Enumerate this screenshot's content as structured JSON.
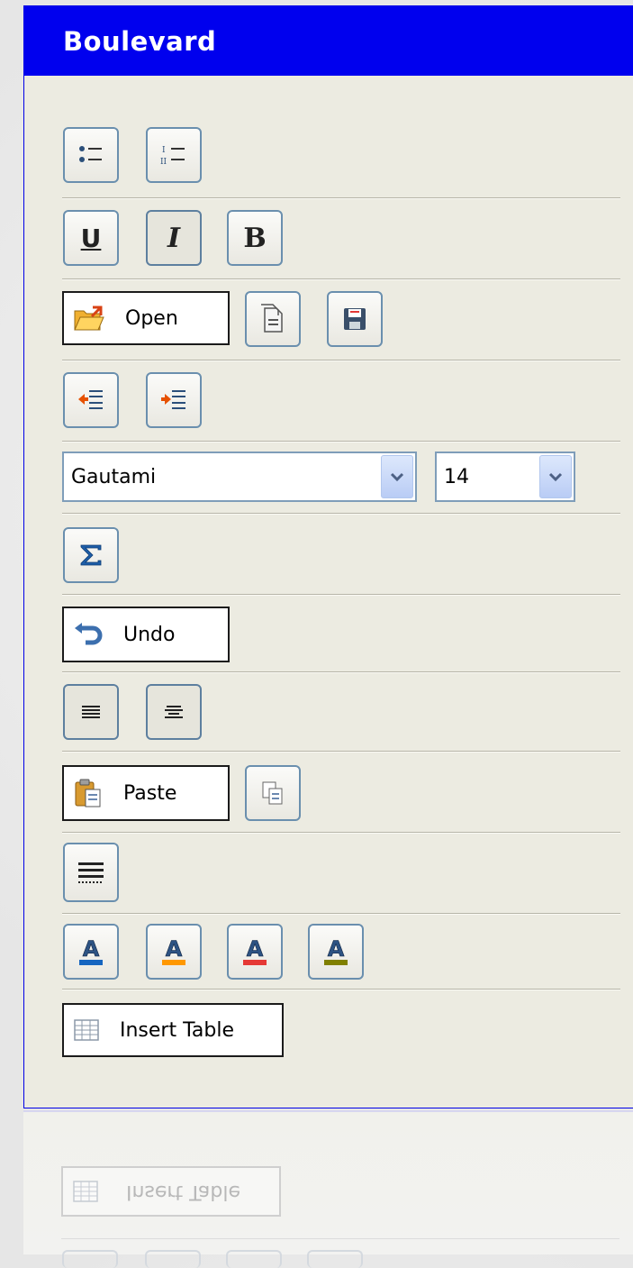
{
  "panel": {
    "title": "Boulevard"
  },
  "toolbar": {
    "list_buttons": [
      {
        "icon": "bulleted-list-icon"
      },
      {
        "icon": "numbered-list-icon"
      }
    ],
    "format_buttons": [
      {
        "icon": "underline-icon",
        "glyph": "U",
        "pressed": false
      },
      {
        "icon": "italic-icon",
        "glyph": "I",
        "pressed": true
      },
      {
        "icon": "bold-icon",
        "glyph": "B",
        "pressed": false
      }
    ],
    "open_label": "Open",
    "undo_label": "Undo",
    "paste_label": "Paste",
    "insert_table_label": "Insert Table",
    "font_select": {
      "value": "Gautami"
    },
    "size_select": {
      "value": "14"
    },
    "color_buttons": [
      {
        "icon": "font-color-blue-icon",
        "color": "#1565c0",
        "glyph": "A"
      },
      {
        "icon": "font-color-orange-icon",
        "color": "#ff9800",
        "glyph": "A"
      },
      {
        "icon": "font-color-red-icon",
        "color": "#e53935",
        "glyph": "A"
      },
      {
        "icon": "font-color-olive-icon",
        "color": "#808000",
        "glyph": "A"
      }
    ]
  },
  "reflection": {
    "label": "Insert Table"
  },
  "colors": {
    "title_bar": "#0000ee",
    "button_border": "#6a8fae"
  }
}
